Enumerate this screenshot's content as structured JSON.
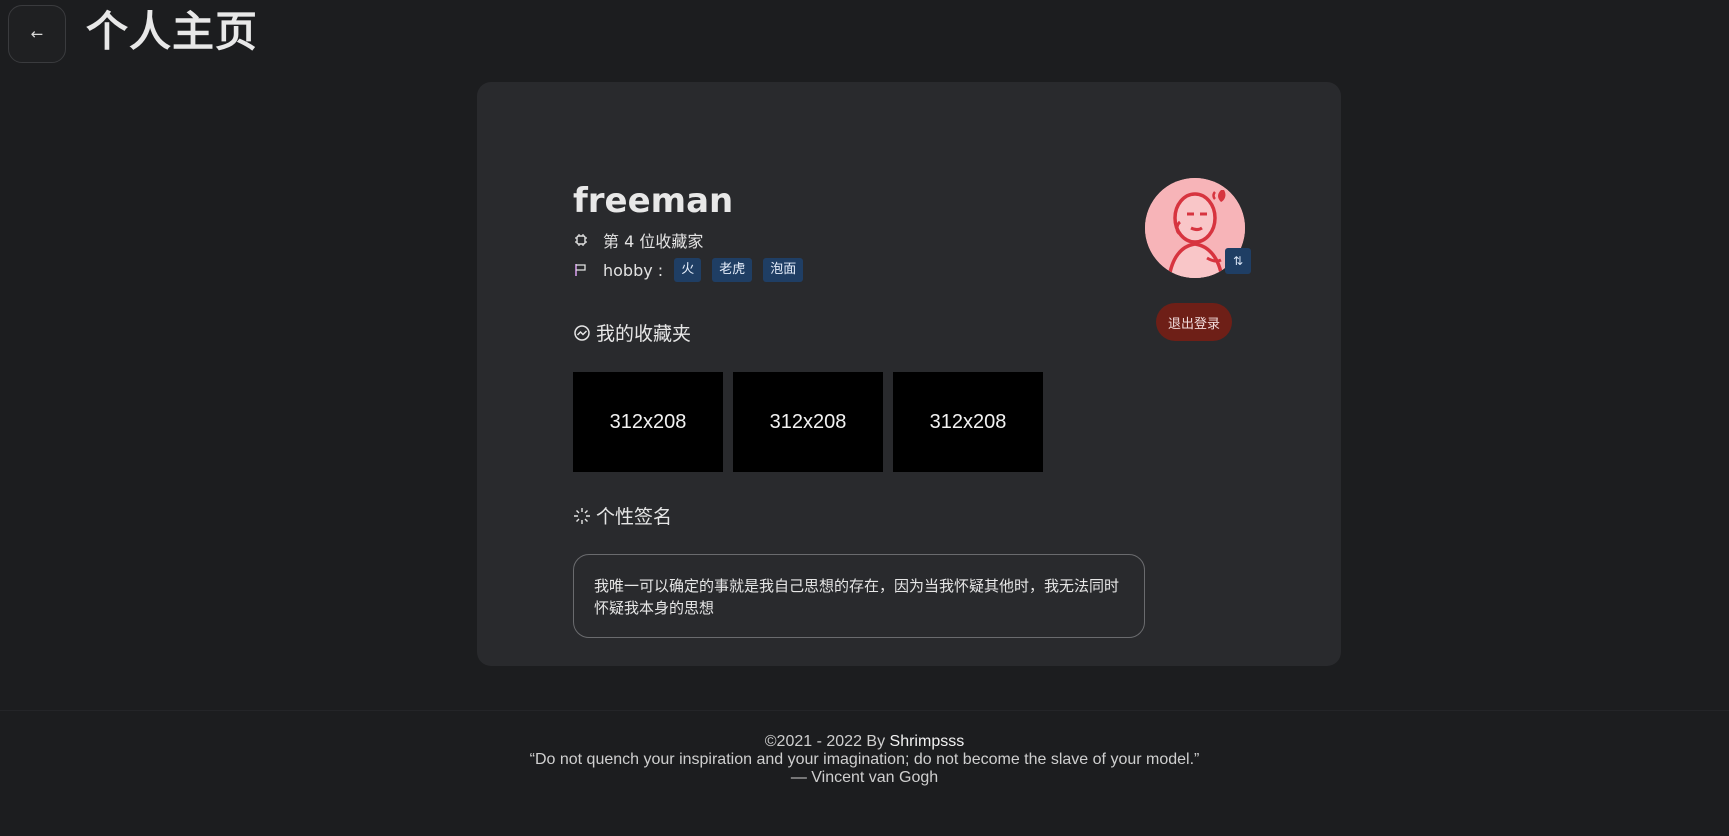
{
  "header": {
    "back_icon": "arrow-left-icon",
    "back_glyph": "←",
    "title": "个人主页"
  },
  "profile": {
    "username": "freeman",
    "rank_icon": "chip-icon",
    "rank_text": "第 4 位收藏家",
    "hobby_icon": "flag-icon",
    "hobby_label": "hobby :",
    "hobbies": [
      "火",
      "老虎",
      "泡面"
    ],
    "avatar_icon": "cartoon-avatar-icon",
    "swap_icon": "swap-icon",
    "swap_glyph": "⇅",
    "logout_label": "退出登录"
  },
  "favorites": {
    "icon": "collection-icon",
    "title": "我的收藏夹",
    "items": [
      "312x208",
      "312x208",
      "312x208"
    ]
  },
  "signature": {
    "icon": "sparkle-icon",
    "title": "个性签名",
    "text": "我唯一可以确定的事就是我自己思想的存在，因为当我怀疑其他时，我无法同时怀疑我本身的思想"
  },
  "footer": {
    "copyright_prefix": "©2021 - 2022 By ",
    "author": "Shrimpsss",
    "quote": "“Do not quench your inspiration and your imagination; do not become the slave of your model.”",
    "attribution": "— Vincent van Gogh"
  },
  "colors": {
    "background": "#1c1d1f",
    "card": "#292a2d",
    "tag": "#1f3e64",
    "logout": "#6e1f17",
    "avatar": "#f7b4b8"
  }
}
